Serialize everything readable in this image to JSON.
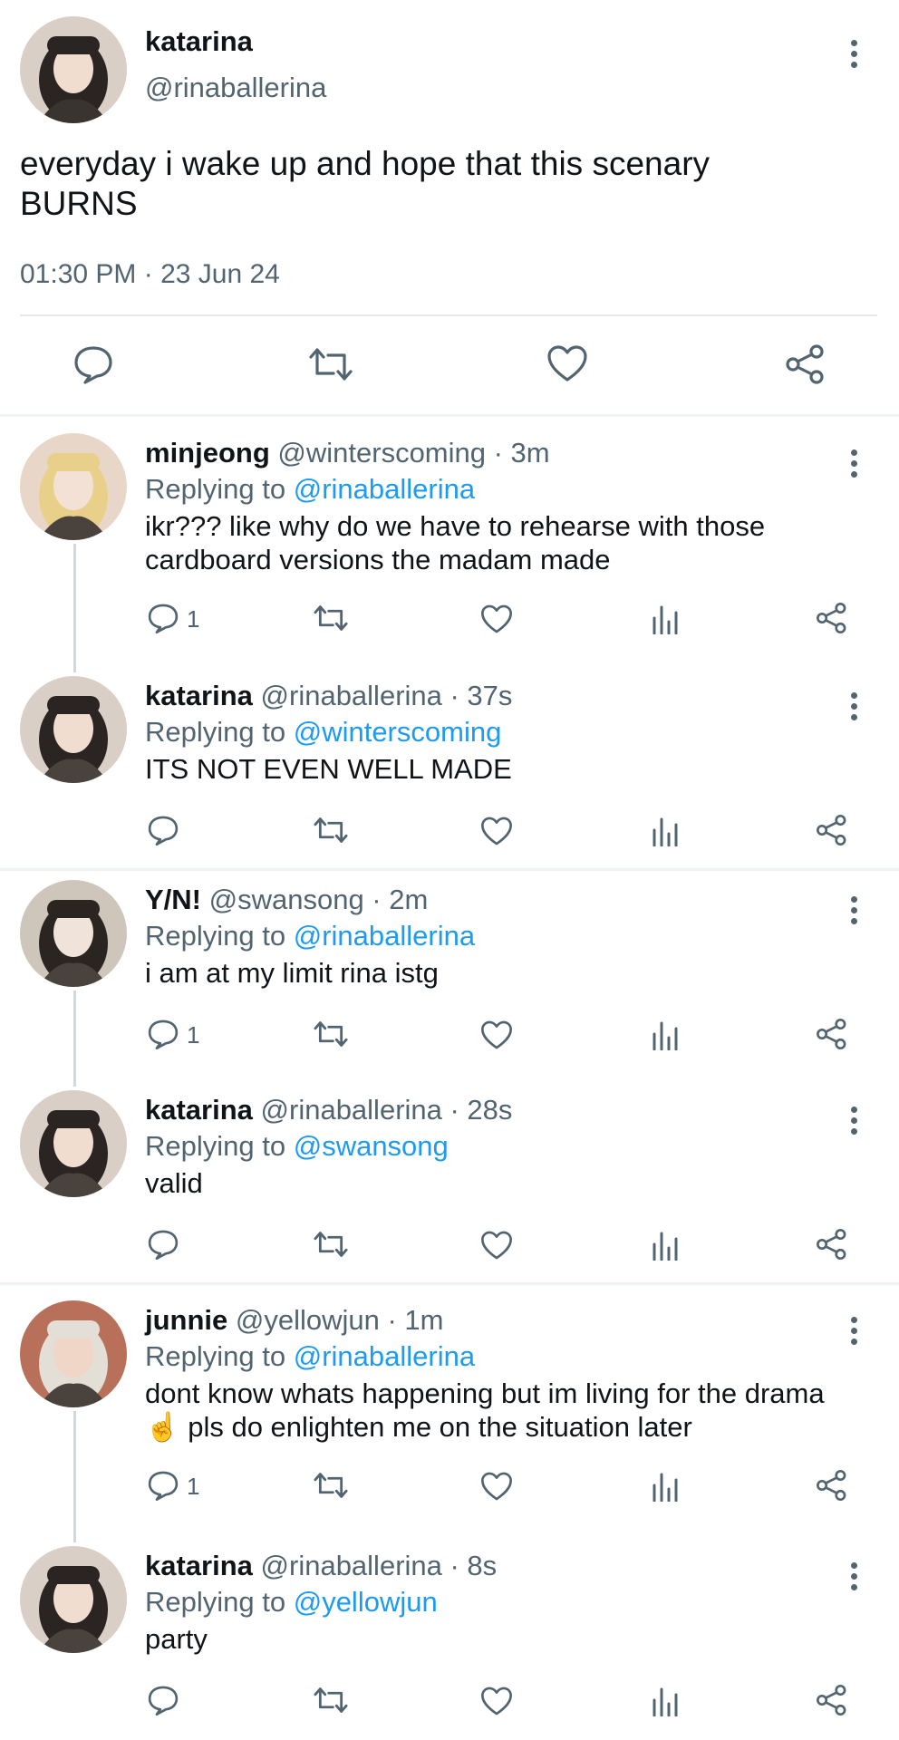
{
  "main_tweet": {
    "name": "katarina",
    "handle": "@rinaballerina",
    "text_line1": "everyday i wake up and hope that this scenary",
    "text_line2": "BURNS",
    "timestamp": "01:30 PM · 23 Jun 24",
    "actions": [
      "reply-icon",
      "retweet-icon",
      "like-icon",
      "share-icon"
    ]
  },
  "replies": [
    {
      "name": "minjeong",
      "meta": "@winterscoming · 3m",
      "replying_label": "Replying to",
      "replying_to": "@rinaballerina",
      "line1": "ikr??? like why do we have to rehearse with those",
      "line2": "cardboard versions the madam made",
      "reply_count": "1"
    },
    {
      "name": "katarina",
      "meta": "@rinaballerina · 37s",
      "replying_label": "Replying to",
      "replying_to": "@winterscoming",
      "line1": "ITS NOT EVEN WELL MADE",
      "line2": "",
      "reply_count": ""
    },
    {
      "name": "Y/N!",
      "meta": "@swansong · 2m",
      "replying_label": "Replying to",
      "replying_to": "@rinaballerina",
      "line1": "i am at my limit rina istg",
      "line2": "",
      "reply_count": "1"
    },
    {
      "name": "katarina",
      "meta": "@rinaballerina · 28s",
      "replying_label": "Replying to",
      "replying_to": "@swansong",
      "line1": "valid",
      "line2": "",
      "reply_count": ""
    },
    {
      "name": "junnie",
      "meta": "@yellowjun · 1m",
      "replying_label": "Replying to",
      "replying_to": "@rinaballerina",
      "line1": "dont know whats happening but im living for the drama",
      "line2": "☝️ pls do enlighten me on the situation later",
      "reply_count": "1"
    },
    {
      "name": "katarina",
      "meta": "@rinaballerina · 8s",
      "replying_label": "Replying to",
      "replying_to": "@yellowjun",
      "line1": "party",
      "line2": "",
      "reply_count": ""
    }
  ],
  "colors": {
    "mention": "#1d9bf0",
    "muted": "#536471",
    "text": "#0f1419"
  }
}
